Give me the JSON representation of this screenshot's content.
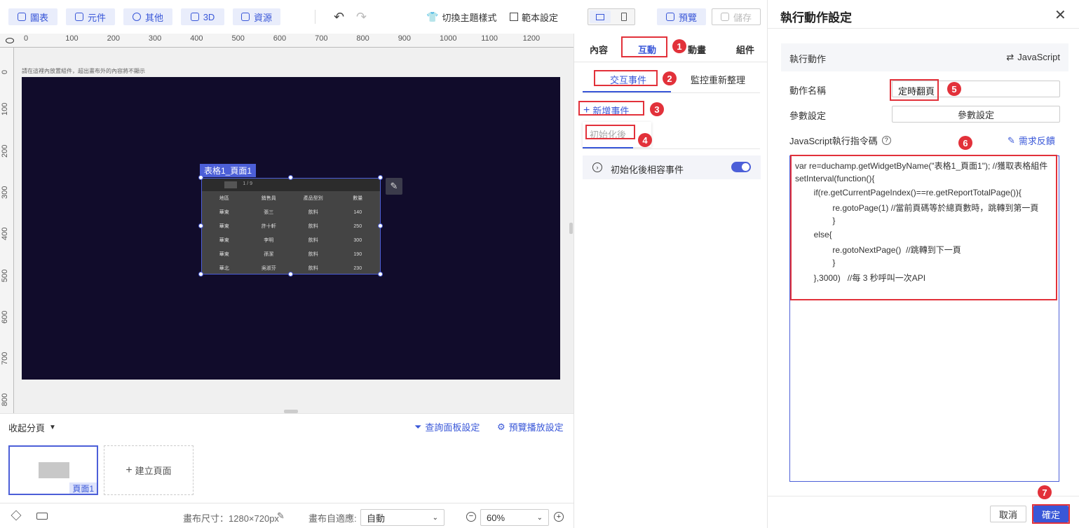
{
  "toolbar": {
    "chart": "圖表",
    "widget": "元件",
    "other": "其他",
    "threed": "3D",
    "resource": "資源",
    "theme": "切換主題樣式",
    "template": "範本設定",
    "preview": "預覽",
    "save": "儲存"
  },
  "canvas": {
    "hint": "請在這裡內放置組件，超出畫布外的內容將不顯示",
    "widget_label": "表格1_頁面1",
    "pager": "1 / 9",
    "headers": [
      "地區",
      "銷售員",
      "產品型別",
      "數量"
    ],
    "rows": [
      [
        "華東",
        "張三",
        "飲料",
        "140"
      ],
      [
        "華東",
        "許十軒",
        "飲料",
        "250"
      ],
      [
        "華東",
        "李明",
        "飲料",
        "300"
      ],
      [
        "華東",
        "孫潔",
        "飲料",
        "190"
      ],
      [
        "華北",
        "吳淑芬",
        "飲料",
        "230"
      ]
    ]
  },
  "rulers": {
    "top": [
      "0",
      "100",
      "200",
      "300",
      "400",
      "500",
      "600",
      "700",
      "800",
      "900",
      "1000",
      "1100",
      "1200"
    ],
    "left": [
      "0",
      "100",
      "200",
      "300",
      "400",
      "500",
      "600",
      "700",
      "800"
    ]
  },
  "pages": {
    "collapse": "收起分頁",
    "query_panel": "查詢面板設定",
    "preview_play": "預覽播放設定",
    "page1": "頁面1",
    "create": "建立頁面"
  },
  "status": {
    "canvas_size": "畫布尺寸：1280×720px",
    "auto_fit_label": "畫布自適應:",
    "auto_fit_value": "自動",
    "zoom": "60%"
  },
  "mid": {
    "tabs": [
      "內容",
      "互動",
      "動畫",
      "組件"
    ],
    "subtabs": [
      "交互事件",
      "監控重新整理"
    ],
    "add_event": "新增事件",
    "after_init": "初始化後",
    "event_name": "初始化後相容事件",
    "badges": [
      "1",
      "2",
      "3",
      "4"
    ]
  },
  "dialog": {
    "title": "執行動作設定",
    "action_label": "執行動作",
    "action_value": "JavaScript",
    "name_label": "動作名稱",
    "name_value": "定時翻頁",
    "param_label": "參數設定",
    "param_button": "參數設定",
    "js_label": "JavaScript執行指令碼",
    "feedback": "需求反饋",
    "code": [
      "var re=duchamp.getWidgetByName(\"表格1_頁面1\"); //獲取表格組件",
      "setInterval(function(){",
      "        if(re.getCurrentPageIndex()==re.getReportTotalPage()){",
      "                re.gotoPage(1) //當前頁碼等於總頁數時，跳轉到第一頁",
      "                }",
      "        else{",
      "                re.gotoNextPage()  //跳轉到下一頁",
      "                }",
      "        },3000)   //每 3 秒呼叫一次API"
    ],
    "cancel": "取消",
    "confirm": "確定",
    "badges": [
      "5",
      "6",
      "7"
    ]
  },
  "colors": {
    "accent": "#3957d8",
    "canvas_bg": "#110c2b",
    "annotation": "#e2313a"
  }
}
